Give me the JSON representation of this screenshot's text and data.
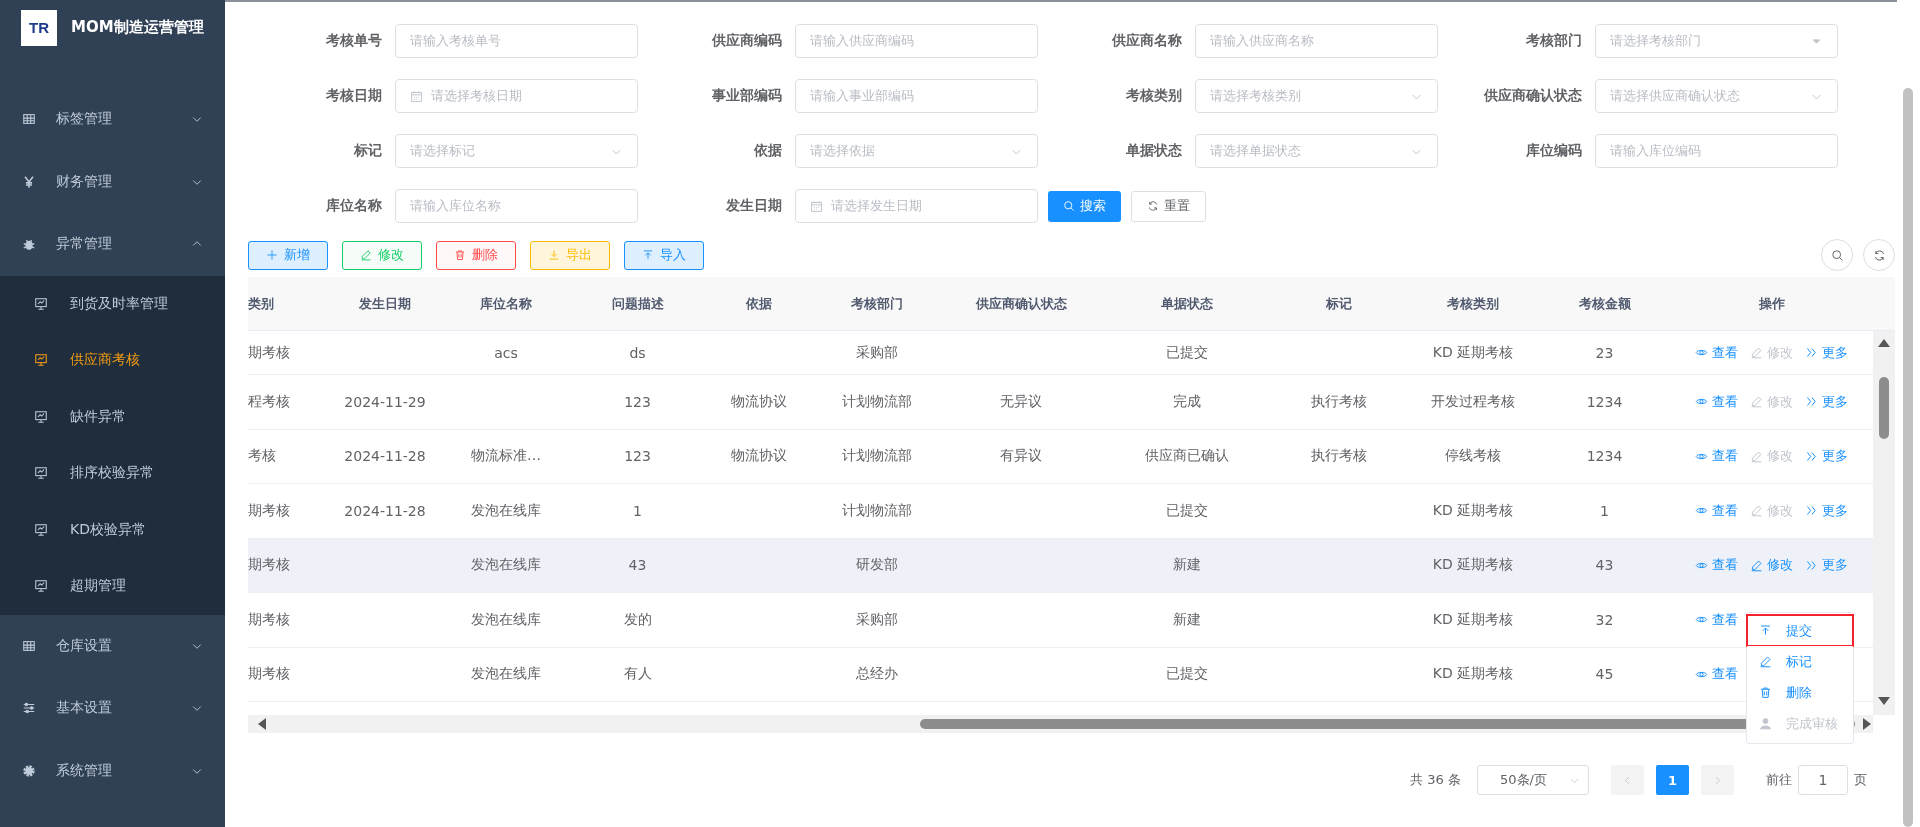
{
  "sidebar": {
    "logo_text": "TR",
    "title": "MOM制造运营管理",
    "menu": [
      {
        "label": "标签管理",
        "expanded": false
      },
      {
        "label": "财务管理",
        "expanded": false
      },
      {
        "label": "异常管理",
        "expanded": true,
        "children": [
          {
            "label": "到货及时率管理",
            "selected": false
          },
          {
            "label": "供应商考核",
            "selected": true
          },
          {
            "label": "缺件异常",
            "selected": false
          },
          {
            "label": "排序校验异常",
            "selected": false
          },
          {
            "label": "KD校验异常",
            "selected": false
          },
          {
            "label": "超期管理",
            "selected": false
          }
        ]
      },
      {
        "label": "仓库设置",
        "expanded": false
      },
      {
        "label": "基本设置",
        "expanded": false
      },
      {
        "label": "系统管理",
        "expanded": false
      }
    ]
  },
  "filters": [
    {
      "label": "考核单号",
      "kind": "input",
      "placeholder": "请输入考核单号"
    },
    {
      "label": "供应商编码",
      "kind": "input",
      "placeholder": "请输入供应商编码"
    },
    {
      "label": "供应商名称",
      "kind": "input",
      "placeholder": "请输入供应商名称"
    },
    {
      "label": "考核部门",
      "kind": "tree-select",
      "placeholder": "请选择考核部门"
    },
    {
      "label": "考核日期",
      "kind": "date",
      "placeholder": "请选择考核日期"
    },
    {
      "label": "事业部编码",
      "kind": "input",
      "placeholder": "请输入事业部编码"
    },
    {
      "label": "考核类别",
      "kind": "select",
      "placeholder": "请选择考核类别"
    },
    {
      "label": "供应商确认状态",
      "kind": "select",
      "placeholder": "请选择供应商确认状态"
    },
    {
      "label": "标记",
      "kind": "select",
      "placeholder": "请选择标记"
    },
    {
      "label": "依据",
      "kind": "select",
      "placeholder": "请选择依据"
    },
    {
      "label": "单据状态",
      "kind": "select",
      "placeholder": "请选择单据状态"
    },
    {
      "label": "库位编码",
      "kind": "input",
      "placeholder": "请输入库位编码"
    },
    {
      "label": "库位名称",
      "kind": "input",
      "placeholder": "请输入库位名称"
    },
    {
      "label": "发生日期",
      "kind": "date",
      "placeholder": "请选择发生日期"
    }
  ],
  "search_button": "搜索",
  "reset_button": "重置",
  "toolbar": [
    {
      "label": "新增",
      "color": "#1890ff",
      "disabled": false
    },
    {
      "label": "修改",
      "color": "#13ce66",
      "disabled": true
    },
    {
      "label": "删除",
      "color": "#ff4949",
      "disabled": true
    },
    {
      "label": "导出",
      "color": "#ffba00",
      "disabled": false
    },
    {
      "label": "导入",
      "color": "#1890ff",
      "disabled": false
    }
  ],
  "table": {
    "columns": [
      "类别",
      "发生日期",
      "库位名称",
      "问题描述",
      "依据",
      "考核部门",
      "供应商确认状态",
      "单据状态",
      "标记",
      "考核类别",
      "考核金额",
      "操作"
    ],
    "rows": [
      {
        "cells": [
          "期考核",
          null,
          "acs",
          "ds",
          null,
          "采购部",
          null,
          "已提交",
          null,
          "KD 延期考核",
          "23"
        ],
        "hover": false,
        "ops": [
          {
            "label": "查看",
            "disabled": false
          },
          {
            "label": "修改",
            "disabled": true
          },
          {
            "label": "更多",
            "disabled": false
          }
        ]
      },
      {
        "cells": [
          "程考核",
          "2024-11-29",
          null,
          "123",
          "物流协议",
          "计划物流部",
          "无异议",
          "完成",
          "执行考核",
          "开发过程考核",
          "1234"
        ],
        "hover": false,
        "ops": [
          {
            "label": "查看",
            "disabled": false
          },
          {
            "label": "修改",
            "disabled": true
          },
          {
            "label": "更多",
            "disabled": false
          }
        ]
      },
      {
        "cells": [
          "考核",
          "2024-11-28",
          "物流标准…",
          "123",
          "物流协议",
          "计划物流部",
          "有异议",
          "供应商已确认",
          "执行考核",
          "停线考核",
          "1234"
        ],
        "hover": false,
        "ops": [
          {
            "label": "查看",
            "disabled": false
          },
          {
            "label": "修改",
            "disabled": true
          },
          {
            "label": "更多",
            "disabled": false
          }
        ]
      },
      {
        "cells": [
          "期考核",
          "2024-11-28",
          "发泡在线库",
          "1",
          null,
          "计划物流部",
          null,
          "已提交",
          null,
          "KD 延期考核",
          "1"
        ],
        "hover": false,
        "ops": [
          {
            "label": "查看",
            "disabled": false
          },
          {
            "label": "修改",
            "disabled": true
          },
          {
            "label": "更多",
            "disabled": false
          }
        ]
      },
      {
        "cells": [
          "期考核",
          null,
          "发泡在线库",
          "43",
          null,
          "研发部",
          null,
          "新建",
          null,
          "KD 延期考核",
          "43"
        ],
        "hover": true,
        "ops": [
          {
            "label": "查看",
            "disabled": false
          },
          {
            "label": "修改",
            "disabled": false
          },
          {
            "label": "更多",
            "disabled": false
          }
        ]
      },
      {
        "cells": [
          "期考核",
          null,
          "发泡在线库",
          "发的",
          null,
          "采购部",
          null,
          "新建",
          null,
          "KD 延期考核",
          "32"
        ],
        "hover": false,
        "ops": [
          {
            "label": "查看",
            "disabled": false
          }
        ]
      },
      {
        "cells": [
          "期考核",
          null,
          "发泡在线库",
          "有人",
          null,
          "总经办",
          null,
          "已提交",
          null,
          "KD 延期考核",
          "45"
        ],
        "hover": false,
        "ops": [
          {
            "label": "查看",
            "disabled": false
          }
        ]
      }
    ]
  },
  "more_menu": [
    {
      "label": "提交",
      "disabled": false,
      "selected": true
    },
    {
      "label": "标记",
      "disabled": false,
      "selected": false
    },
    {
      "label": "删除",
      "disabled": false,
      "selected": false
    },
    {
      "label": "完成审核",
      "disabled": true,
      "selected": false
    }
  ],
  "pagination": {
    "total": "共 36 条",
    "page_size": "50条/页",
    "pages": [
      {
        "label": "1",
        "selected": true
      }
    ],
    "goto_label": "前往",
    "goto_value": "1",
    "goto_suffix": "页"
  }
}
